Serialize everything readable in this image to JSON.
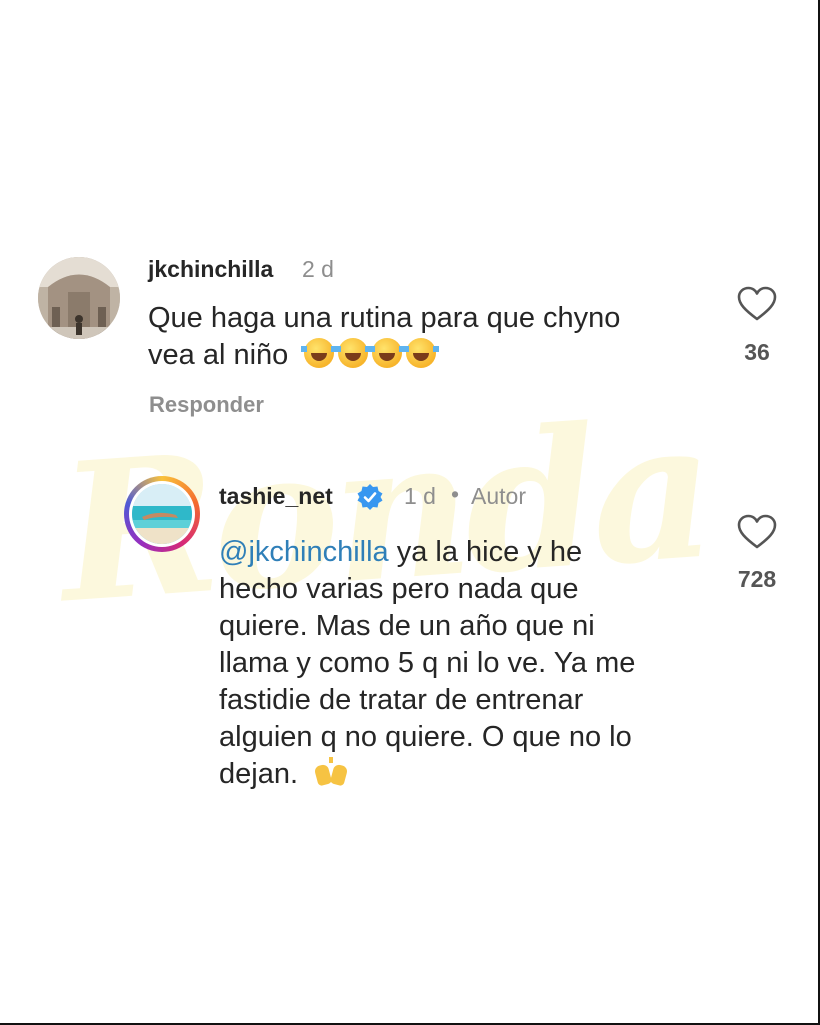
{
  "comment": {
    "username": "jkchinchilla",
    "time": "2 d",
    "text_line1": "Que haga una rutina para que chyno",
    "text_line2": "vea al niño",
    "emoji": "face-with-tears-of-joy x4",
    "reply_label": "Responder",
    "likes": "36"
  },
  "reply": {
    "username": "tashie_net",
    "verified_icon": "verified-badge-icon",
    "time": "1 d",
    "separator": "•",
    "author_tag": "Autor",
    "mention": "@jkchinchilla",
    "line1_rest": " ya la hice y he",
    "line2": "hecho varias pero nada que",
    "line3": "quiere. Mas de un año que ni",
    "line4": "llama y como 5 q ni lo ve. Ya me",
    "line5": "fastidie de tratar de entrenar",
    "line6": "alguien q no quiere. O que no lo",
    "line7": "dejan.",
    "emoji": "raising-hands",
    "likes": "728"
  },
  "watermark": "Ronda",
  "colors": {
    "text": "#262626",
    "muted": "#8e8e8e",
    "mention": "#2f7fb8",
    "verified": "#3897f0",
    "watermark": "#fbf3c2"
  }
}
